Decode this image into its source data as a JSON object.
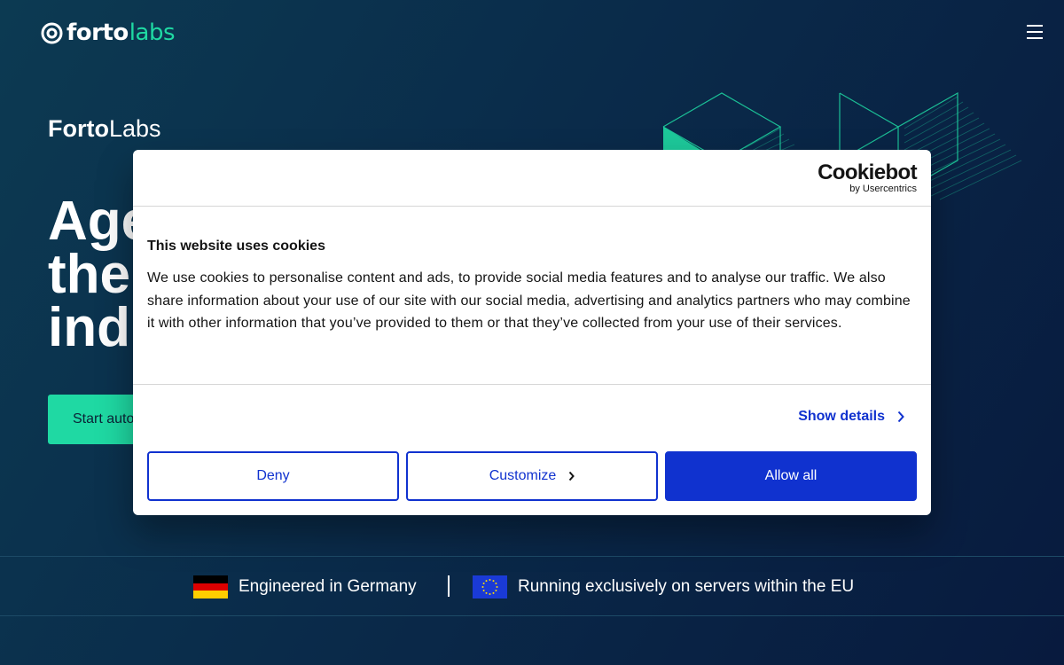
{
  "header": {
    "logo_primary": "forto",
    "logo_secondary": "labs",
    "menu_icon": "hamburger-menu-icon"
  },
  "hero": {
    "brand_bold": "Forto",
    "brand_light": "Labs",
    "headline_lines": [
      "Age",
      "the",
      "indu"
    ],
    "cta_label": "Start auto"
  },
  "trust_bar": {
    "germany_text": "Engineered in Germany",
    "eu_text": "Running exclusively on servers within the EU",
    "germany_flag": "germany-flag-icon",
    "eu_flag": "eu-flag-icon"
  },
  "cookie_dialog": {
    "provider_name": "Cookiebot",
    "provider_sub": "by Usercentrics",
    "title": "This website uses cookies",
    "body": "We use cookies to personalise content and ads, to provide social media features and to analyse our traffic. We also share information about your use of our site with our social media, advertising and analytics partners who may combine it with other information that you’ve provided to them or that they’ve collected from your use of their services.",
    "show_details_label": "Show details",
    "deny_label": "Deny",
    "customize_label": "Customize",
    "allow_label": "Allow all"
  },
  "colors": {
    "accent_green": "#1fd9a3",
    "cookie_blue": "#1032cf",
    "background_dark": "#0a2b4a"
  }
}
